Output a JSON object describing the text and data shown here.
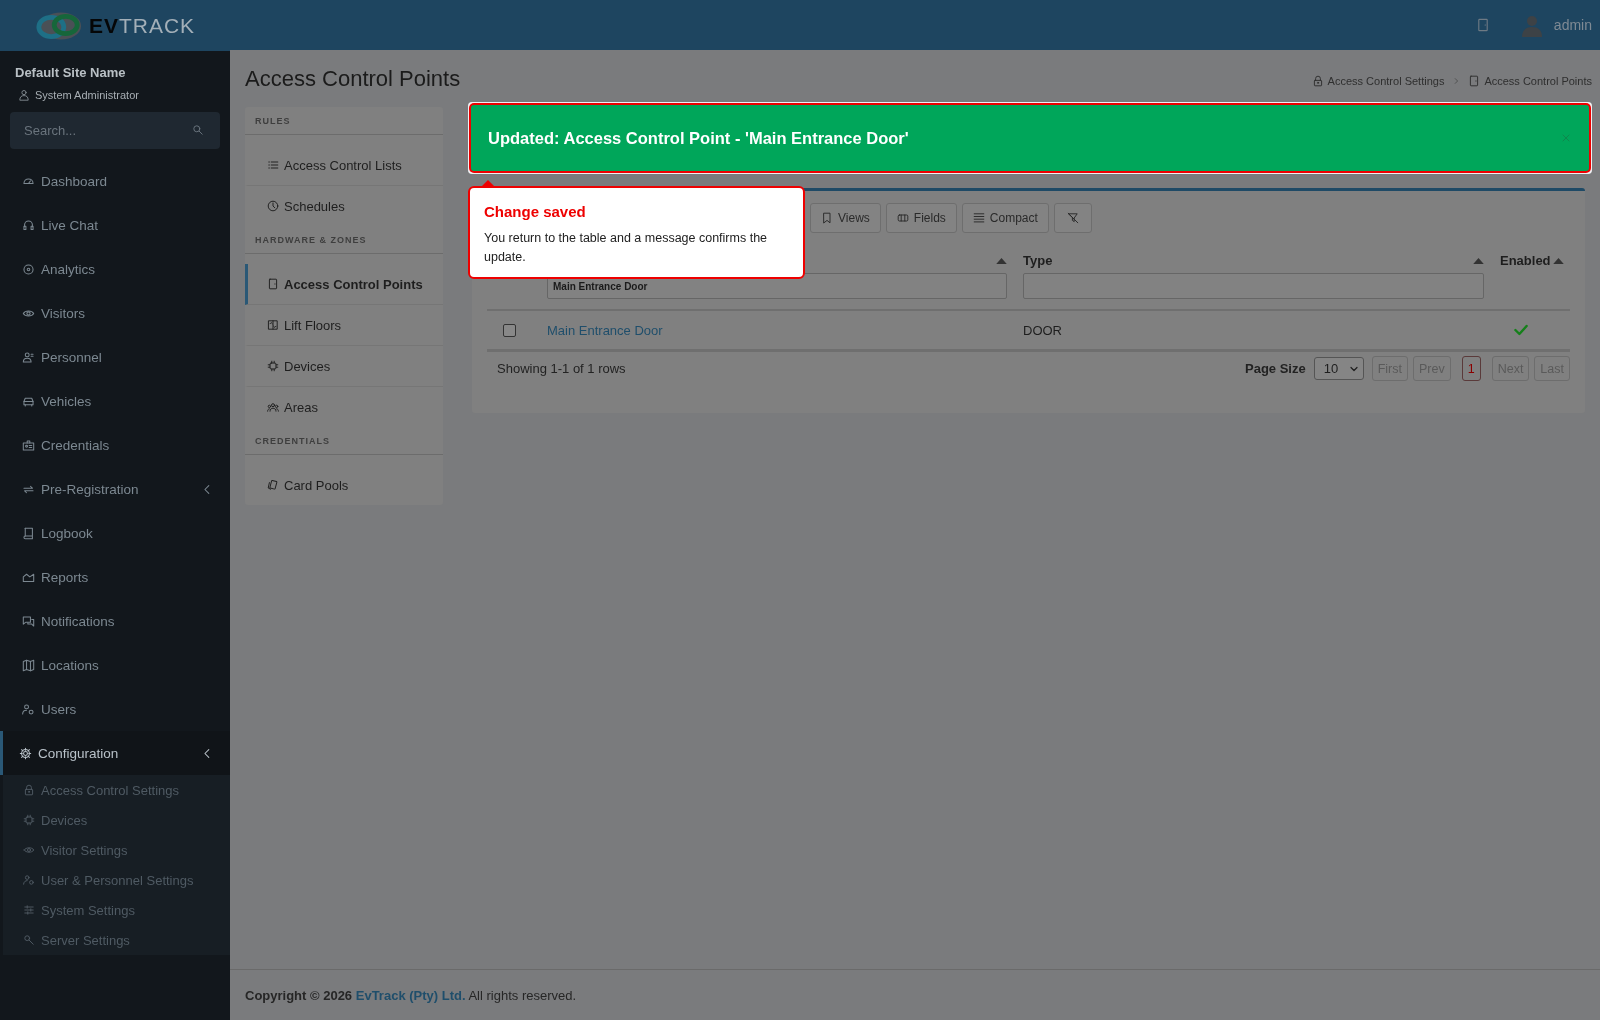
{
  "header": {
    "logo": {
      "bold": "EV",
      "light": "TRACK"
    },
    "user": "admin"
  },
  "sidebar": {
    "site_name": "Default Site Name",
    "role": "System Administrator",
    "search": {
      "placeholder": "Search..."
    },
    "items": [
      {
        "label": "Dashboard",
        "selected": false
      },
      {
        "label": "Live Chat",
        "selected": false
      },
      {
        "label": "Analytics",
        "selected": false
      },
      {
        "label": "Visitors",
        "selected": false
      },
      {
        "label": "Personnel",
        "selected": false
      },
      {
        "label": "Vehicles",
        "selected": false
      },
      {
        "label": "Credentials",
        "selected": false
      },
      {
        "label": "Pre-Registration",
        "selected": false,
        "expandable": true
      },
      {
        "label": "Logbook",
        "selected": false
      },
      {
        "label": "Reports",
        "selected": false
      },
      {
        "label": "Notifications",
        "selected": false
      },
      {
        "label": "Locations",
        "selected": false
      },
      {
        "label": "Users",
        "selected": false
      },
      {
        "label": "Configuration",
        "selected": true,
        "expandable": true,
        "children": [
          {
            "label": "Access Control Settings"
          },
          {
            "label": "Devices"
          },
          {
            "label": "Visitor Settings"
          },
          {
            "label": "User & Personnel Settings"
          },
          {
            "label": "System Settings"
          },
          {
            "label": "Server Settings"
          }
        ]
      }
    ]
  },
  "page": {
    "title": "Access Control Points",
    "breadcrumb": [
      "Access Control Settings",
      "Access Control Points"
    ]
  },
  "settings_nav": [
    {
      "title": "RULES",
      "items": [
        {
          "label": "Access Control Lists",
          "selected": false
        },
        {
          "label": "Schedules",
          "selected": false
        }
      ]
    },
    {
      "title": "HARDWARE & ZONES",
      "items": [
        {
          "label": "Access Control Points",
          "selected": true
        },
        {
          "label": "Lift Floors",
          "selected": false
        },
        {
          "label": "Devices",
          "selected": false
        },
        {
          "label": "Areas",
          "selected": false
        }
      ]
    },
    {
      "title": "CREDENTIALS",
      "items": [
        {
          "label": "Card Pools",
          "selected": false
        }
      ]
    }
  ],
  "alert": {
    "message": "Updated: Access Control Point - 'Main Entrance Door'",
    "highlighted": true
  },
  "tooltip": {
    "title": "Change saved",
    "body": "You return to the table and a message confirms the update."
  },
  "toolbar": [
    "Views",
    "Fields",
    "Compact"
  ],
  "table": {
    "columns": [
      {
        "kind": "name",
        "filter": "Main Entrance Door"
      },
      {
        "kind": "type",
        "label": "Type"
      },
      {
        "kind": "enabled",
        "label": "Enabled"
      }
    ],
    "rows": [
      {
        "checked": false,
        "name": "Main Entrance Door",
        "type": "DOOR",
        "enabled": true
      }
    ]
  },
  "pagination": {
    "summary": "Showing 1-1 of 1 rows",
    "page_size_label": "Page Size",
    "page_size": "10",
    "buttons": [
      {
        "kind": "nav",
        "label": "First",
        "disabled": true
      },
      {
        "kind": "nav",
        "label": "Prev",
        "disabled": true
      },
      {
        "kind": "page",
        "label": "1",
        "selected": true
      },
      {
        "kind": "nav",
        "label": "Next",
        "disabled": true
      },
      {
        "kind": "nav",
        "label": "Last",
        "disabled": true
      }
    ]
  },
  "footer": {
    "prefix": "**Copyright © 2026**",
    "link": "EvTrack (Pty) Ltd.",
    "suffix": "All rights reserved."
  }
}
